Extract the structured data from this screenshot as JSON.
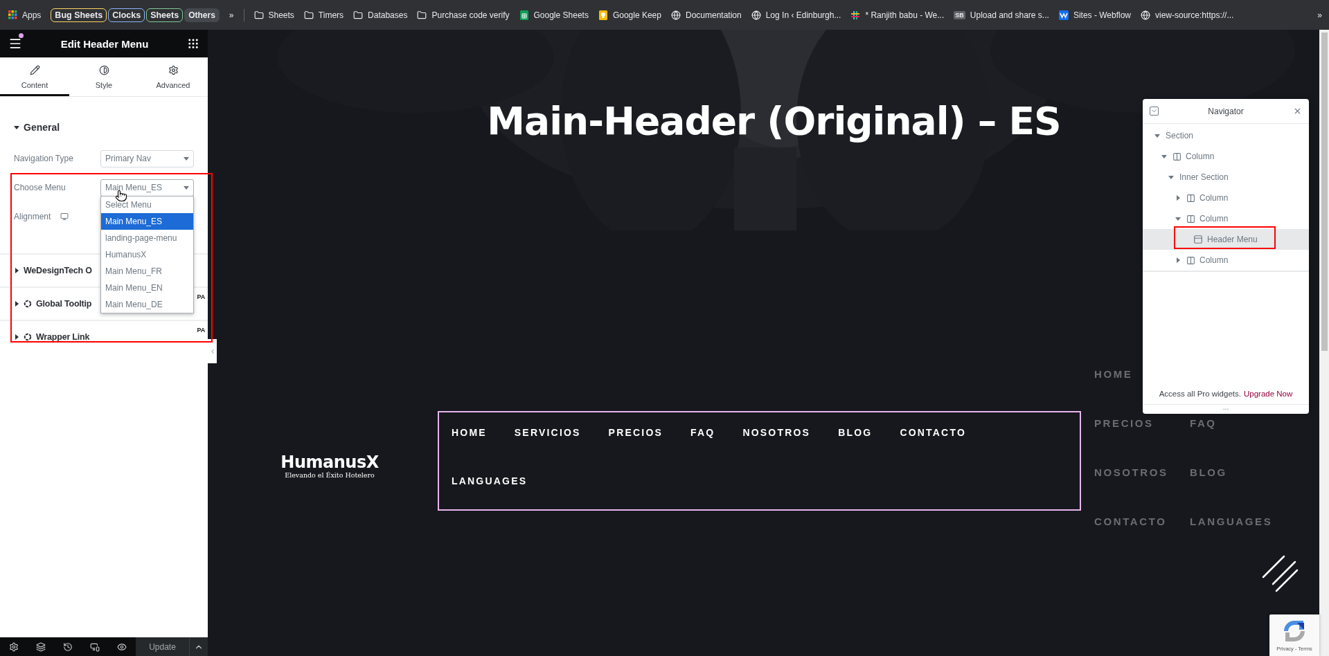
{
  "bookmarks_bar": {
    "apps": "Apps",
    "groups": [
      {
        "label": "Bug Sheets",
        "color": "#fdd663"
      },
      {
        "label": "Clocks",
        "color": "#8ab4f8"
      },
      {
        "label": "Sheets",
        "color": "#81c995"
      }
    ],
    "others": "Others",
    "overflow_left": "»",
    "bookmarks": [
      {
        "label": "Sheets",
        "kind": "folder"
      },
      {
        "label": "Timers",
        "kind": "folder"
      },
      {
        "label": "Databases",
        "kind": "folder"
      },
      {
        "label": "Purchase code verify",
        "kind": "folder"
      },
      {
        "label": "Google Sheets",
        "kind": "sheets"
      },
      {
        "label": "Google Keep",
        "kind": "keep"
      },
      {
        "label": "Documentation",
        "kind": "globe"
      },
      {
        "label": "Log In ‹ Edinburgh...",
        "kind": "globe"
      },
      {
        "label": "* Ranjith babu - We...",
        "kind": "hash"
      },
      {
        "label": "Upload and share s...",
        "kind": "badge",
        "badge_text": "SB"
      },
      {
        "label": "Sites - Webflow",
        "kind": "webflow"
      },
      {
        "label": "view-source:https://...",
        "kind": "globe"
      }
    ],
    "overflow_right": "»"
  },
  "panel": {
    "title": "Edit Header Menu",
    "tabs": [
      {
        "label": "Content",
        "kind": "pencil",
        "selected": true
      },
      {
        "label": "Style",
        "kind": "contrast",
        "selected": false
      },
      {
        "label": "Advanced",
        "kind": "gear",
        "selected": false
      }
    ],
    "sections": [
      {
        "title": "General",
        "expanded": true,
        "kind": "plain",
        "controls": [
          {
            "label": "Navigation Type",
            "kind": "select",
            "value": "Primary Nav",
            "open": false
          },
          {
            "label": "Choose Menu",
            "kind": "select",
            "value": "Main Menu_ES",
            "open": true
          },
          {
            "label": "Alignment",
            "kind": "responsive"
          }
        ]
      },
      {
        "title": "WeDesignTech O",
        "expanded": false,
        "kind": "plain"
      },
      {
        "title": "Global Tooltip",
        "expanded": false,
        "kind": "addon",
        "badge": "PA"
      },
      {
        "title": "Wrapper Link",
        "expanded": false,
        "kind": "addon",
        "badge": "PA"
      }
    ],
    "dropdown_options": [
      {
        "label": "Select Menu",
        "selected": false
      },
      {
        "label": "Main Menu_ES",
        "selected": true
      },
      {
        "label": "landing-page-menu",
        "selected": false
      },
      {
        "label": "HumanusX",
        "selected": false
      },
      {
        "label": "Main Menu_FR",
        "selected": false
      },
      {
        "label": "Main Menu_EN",
        "selected": false
      },
      {
        "label": "Main Menu_DE",
        "selected": false
      }
    ],
    "footer": {
      "update_button": "Update"
    }
  },
  "canvas": {
    "page_title": "Main-Header (Original) – ES",
    "logo": {
      "name": "HumanusX",
      "tagline": "Elevando el Éxito Hotelero"
    },
    "menu": [
      "HOME",
      "SERVICIOS",
      "PRECIOS",
      "FAQ",
      "NOSOTROS",
      "BLOG",
      "CONTACTO",
      "LANGUAGES"
    ],
    "side_menu_rows": [
      {
        "items": [
          "HOME"
        ]
      },
      {
        "items": [
          "PRECIOS",
          "FAQ"
        ]
      },
      {
        "items": [
          "NOSOTROS",
          "BLOG"
        ]
      },
      {
        "items": [
          "CONTACTO",
          "LANGUAGES"
        ]
      }
    ],
    "recaptcha": "Privacy - Terms"
  },
  "navigator": {
    "title": "Navigator",
    "tree": [
      {
        "label": "Section",
        "kind": "section",
        "expanded": true,
        "selected": false,
        "children": [
          {
            "label": "Column",
            "kind": "column",
            "expanded": true,
            "selected": false,
            "children": [
              {
                "label": "Inner Section",
                "kind": "section",
                "expanded": true,
                "selected": false,
                "children": [
                  {
                    "label": "Column",
                    "kind": "column",
                    "expanded": false,
                    "selected": false
                  },
                  {
                    "label": "Column",
                    "kind": "column",
                    "expanded": true,
                    "selected": false,
                    "children": [
                      {
                        "label": "Header Menu",
                        "kind": "widget",
                        "selected": true
                      }
                    ]
                  },
                  {
                    "label": "Column",
                    "kind": "column",
                    "expanded": false,
                    "selected": false
                  }
                ]
              }
            ]
          }
        ]
      }
    ],
    "promo": "Access all Pro widgets.",
    "promo_link": "Upgrade Now",
    "handle": "..."
  }
}
